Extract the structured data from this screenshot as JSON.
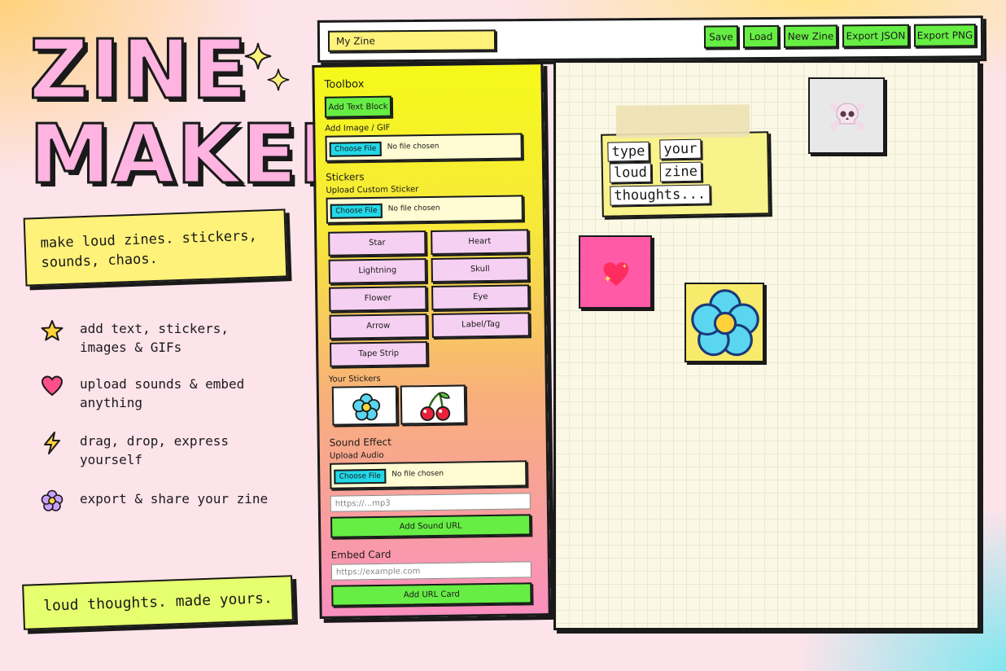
{
  "hero": {
    "title_line1": "ZINE",
    "title_line2": "MAKER",
    "tagline": "make loud zines. stickers, sounds, chaos.",
    "features": [
      {
        "icon": "star-icon",
        "text": "add text, stickers, images & GIFs"
      },
      {
        "icon": "heart-icon",
        "text": "upload sounds & embed anything"
      },
      {
        "icon": "lightning-icon",
        "text": "drag, drop, express yourself"
      },
      {
        "icon": "flower-icon",
        "text": "export & share your zine"
      }
    ],
    "footer": "loud thoughts. made yours."
  },
  "topbar": {
    "zine_name": "My Zine",
    "save": "Save",
    "load": "Load",
    "new_zine": "New Zine",
    "export_json": "Export JSON",
    "export_png": "Export PNG"
  },
  "toolbox": {
    "title": "Toolbox",
    "add_text_block": "Add Text Block",
    "add_image_label": "Add Image / GIF",
    "choose_file": "Choose File",
    "no_file": "No file chosen",
    "stickers_title": "Stickers",
    "upload_custom_sticker": "Upload Custom Sticker",
    "sticker_buttons": [
      "Star",
      "Heart",
      "Lightning",
      "Skull",
      "Flower",
      "Eye",
      "Arrow",
      "Label/Tag",
      "Tape Strip"
    ],
    "your_stickers": "Your Stickers",
    "sound_effect": "Sound Effect",
    "upload_audio": "Upload Audio",
    "sound_url_placeholder": "https://...mp3",
    "add_sound_url": "Add Sound URL",
    "embed_card": "Embed Card",
    "embed_url_placeholder": "https://example.com",
    "add_url_card": "Add URL Card"
  },
  "canvas": {
    "words": [
      "type",
      "your",
      "loud",
      "zine",
      "thoughts..."
    ]
  },
  "colors": {
    "accent_green": "#66ee44",
    "accent_yellow": "#fff27a",
    "accent_pink": "#ffb3e0",
    "accent_cyan": "#22d8e8"
  }
}
